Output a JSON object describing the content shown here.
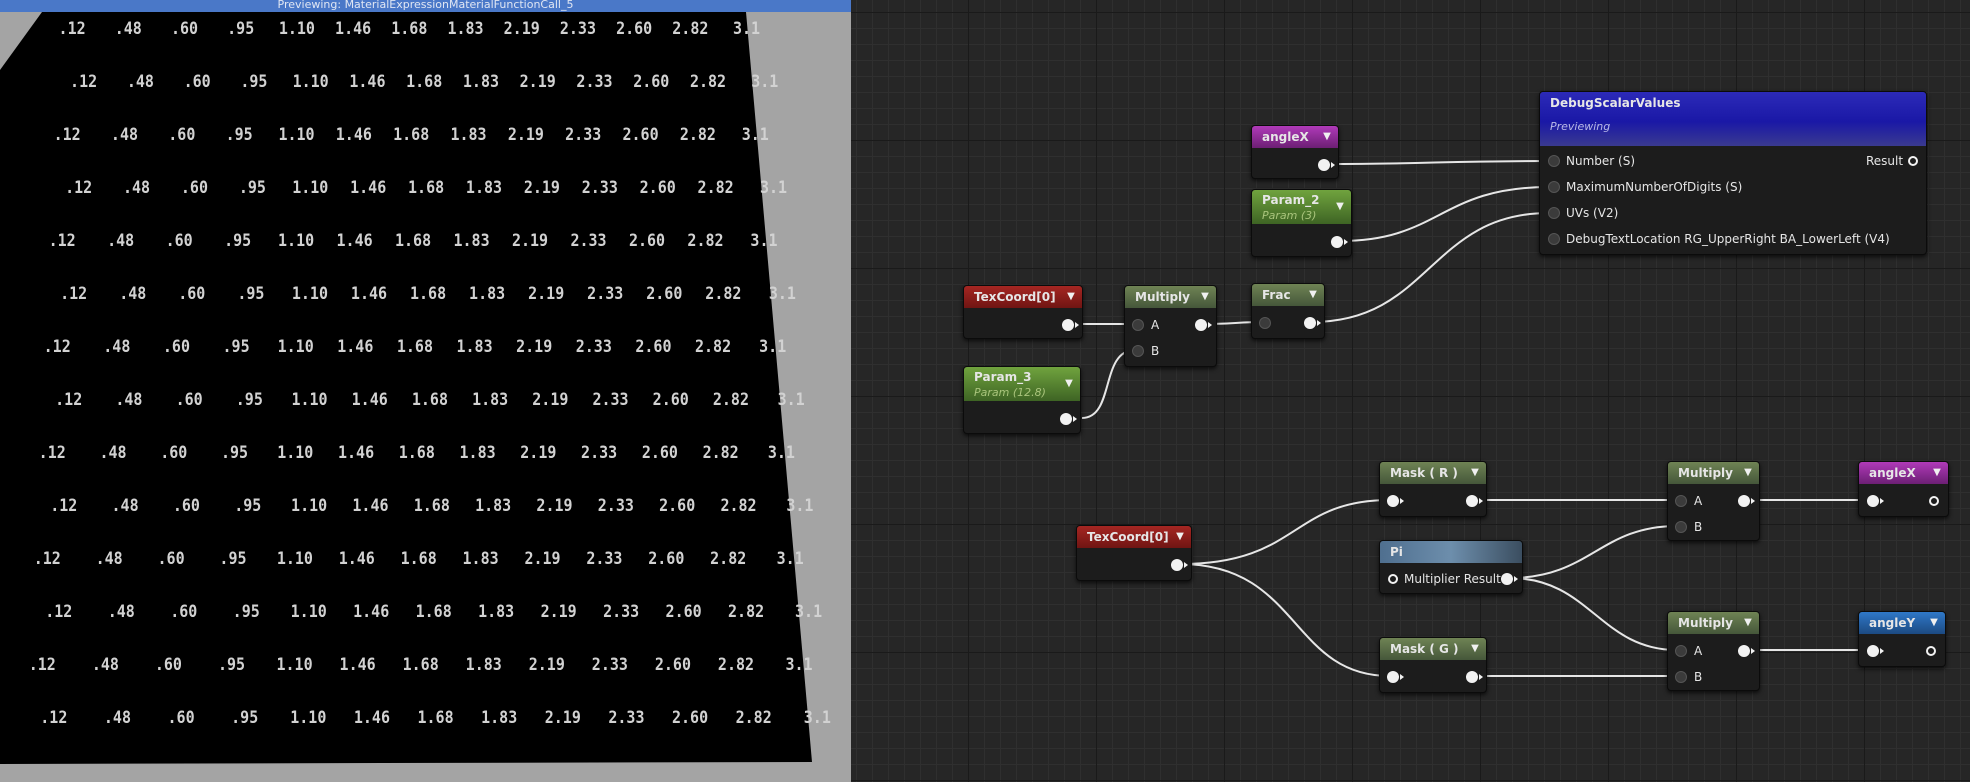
{
  "preview": {
    "title": "Previewing: MaterialExpressionMaterialFunctionCall_5",
    "grid_values": [
      ".12",
      ".48",
      ".60",
      ".95",
      "1.10",
      "1.46",
      "1.68",
      "1.83",
      "2.19",
      "2.33",
      "2.60",
      "2.82",
      "3.1"
    ]
  },
  "nodes": {
    "debug": {
      "title": "DebugScalarValues",
      "subtitle": "Previewing",
      "inputs": [
        "Number (S)",
        "MaximumNumberOfDigits (S)",
        "UVs (V2)",
        "DebugTextLocation RG_UpperRight BA_LowerLeft (V4)"
      ],
      "output": "Result"
    },
    "angleX_top": {
      "title": "angleX"
    },
    "param2": {
      "title": "Param_2",
      "subtitle": "Param (3)"
    },
    "texcoord_top": {
      "title": "TexCoord[0]"
    },
    "multiply_top": {
      "title": "Multiply",
      "inputs": [
        "A",
        "B"
      ]
    },
    "frac": {
      "title": "Frac"
    },
    "param3": {
      "title": "Param_3",
      "subtitle": "Param (12.8)"
    },
    "mask_r": {
      "title": "Mask ( R )"
    },
    "texcoord_bottom": {
      "title": "TexCoord[0]"
    },
    "pi": {
      "title": "Pi",
      "output": "Multiplier Result"
    },
    "mask_g": {
      "title": "Mask ( G )"
    },
    "multiply_b1": {
      "title": "Multiply",
      "inputs": [
        "A",
        "B"
      ]
    },
    "multiply_b2": {
      "title": "Multiply",
      "inputs": [
        "A",
        "B"
      ]
    },
    "angleX_bottom": {
      "title": "angleX"
    },
    "angleY": {
      "title": "angleY"
    }
  },
  "colors": {
    "texcoord": "#a52622",
    "operator": "#6f8354",
    "parameter": "#70a33e",
    "named_reroute_x": "#b03ab9",
    "named_reroute_y": "#2f78c8",
    "constant": "#4f6f8f",
    "function_call": "#2c2ab8"
  }
}
